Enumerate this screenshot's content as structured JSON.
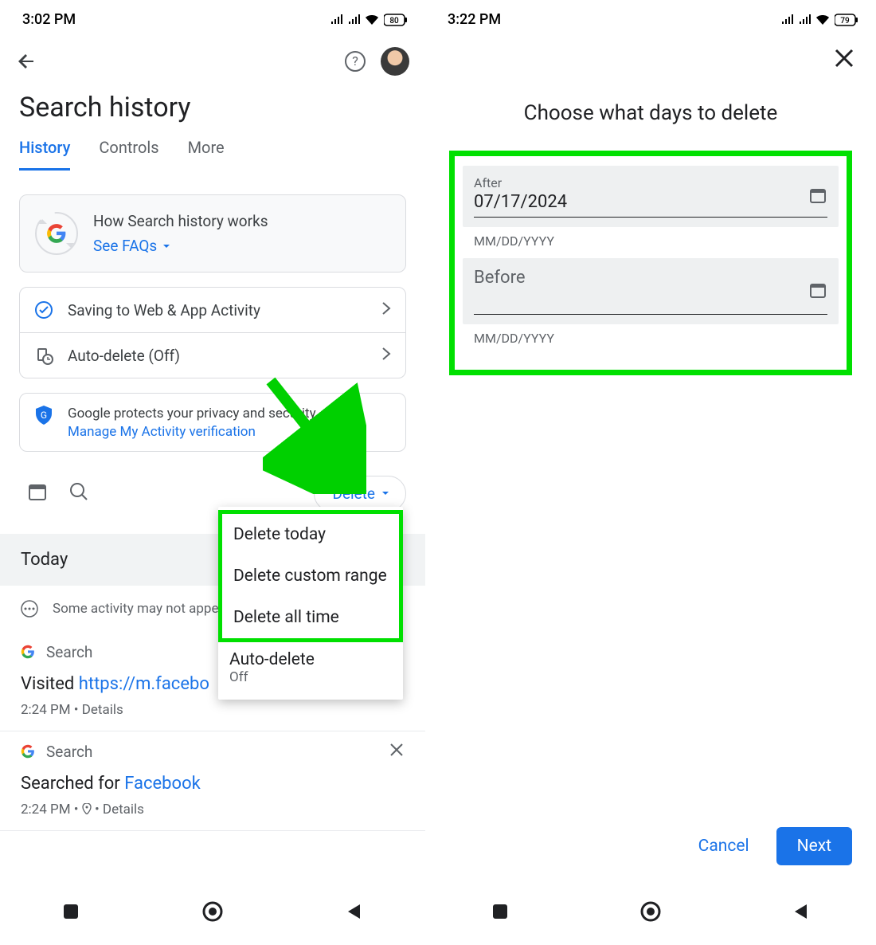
{
  "left": {
    "status": {
      "time": "3:02 PM",
      "battery": "80"
    },
    "page_title": "Search history",
    "tabs": [
      {
        "label": "History",
        "active": true
      },
      {
        "label": "Controls",
        "active": false
      },
      {
        "label": "More",
        "active": false
      }
    ],
    "info_card": {
      "title": "How Search history works",
      "faq": "See FAQs"
    },
    "settings": [
      {
        "label": "Saving to Web & App Activity"
      },
      {
        "label": "Auto-delete (Off)"
      }
    ],
    "privacy": {
      "text": "Google protects your privacy and security.",
      "link": "Manage My Activity verification"
    },
    "delete_button": "Delete",
    "day_header": "Today",
    "notice": "Some activity may not appe",
    "activities": [
      {
        "source": "Search",
        "prefix": "Visited ",
        "link": "https://m.facebo",
        "time": "2:24 PM",
        "details": "Details"
      },
      {
        "source": "Search",
        "prefix": "Searched for ",
        "link": "Facebook",
        "time": "2:24 PM",
        "details": "Details"
      }
    ],
    "menu": {
      "items": [
        "Delete today",
        "Delete custom range",
        "Delete all time"
      ],
      "auto": "Auto-delete",
      "auto_sub": "Off"
    }
  },
  "right": {
    "status": {
      "time": "3:22 PM",
      "battery": "79"
    },
    "title": "Choose what days to delete",
    "fields": [
      {
        "label": "After",
        "value": "07/17/2024",
        "hint": "MM/DD/YYYY"
      },
      {
        "label": "Before",
        "value": "",
        "hint": "MM/DD/YYYY"
      }
    ],
    "cancel": "Cancel",
    "next": "Next"
  }
}
